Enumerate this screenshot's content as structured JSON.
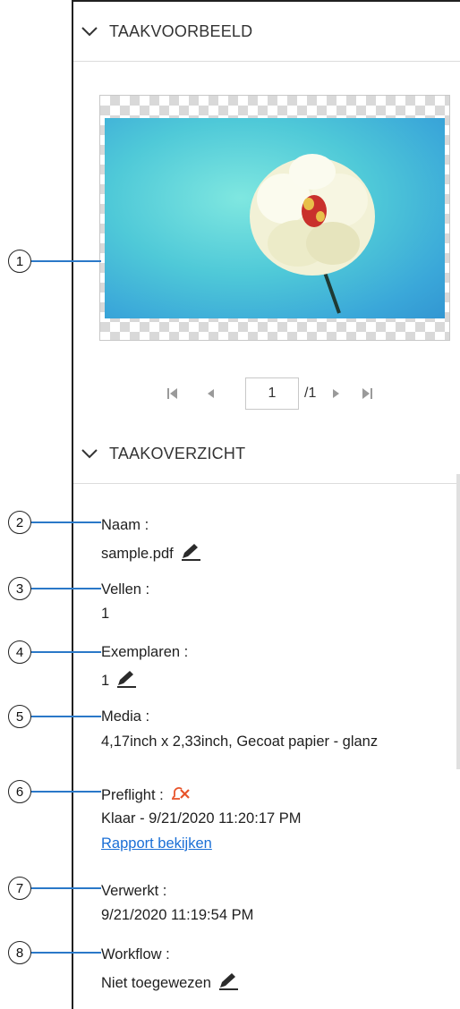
{
  "preview": {
    "section_title": "TAAKVOORBEELD",
    "page_current": "1",
    "page_total": "/1"
  },
  "summary": {
    "section_title": "TAAKOVERZICHT",
    "fields": [
      {
        "label": "Naam :",
        "value": "sample.pdf"
      },
      {
        "label": "Vellen :",
        "value": "1"
      },
      {
        "label": "Exemplaren :",
        "value": "1"
      },
      {
        "label": "Media :",
        "value": "4,17inch x 2,33inch, Gecoat papier - glanz"
      },
      {
        "label": "Preflight :",
        "value": "Klaar - 9/21/2020 11:20:17 PM",
        "link": "Rapport bekijken"
      },
      {
        "label": "Verwerkt :",
        "value": "9/21/2020 11:19:54 PM"
      },
      {
        "label": "Workflow :",
        "value": "Niet toegewezen"
      }
    ]
  },
  "callouts": [
    "1",
    "2",
    "3",
    "4",
    "5",
    "6",
    "7",
    "8"
  ],
  "colors": {
    "link": "#1a6fd6",
    "alert": "#e8542b",
    "callout_line": "#2a78c8"
  },
  "icons": [
    "chevron-down-icon",
    "first-page-icon",
    "prev-page-icon",
    "next-page-icon",
    "last-page-icon",
    "edit-pencil-icon",
    "alert-bell-icon"
  ]
}
